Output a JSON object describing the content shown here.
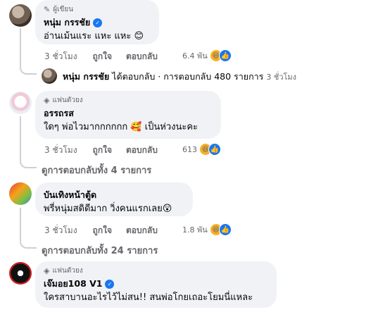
{
  "comments": [
    {
      "badge": "ผู้เขียน",
      "badge_icon": "pencil-icon",
      "name": "หนุ่ม กรรชัย",
      "verified": true,
      "text": "อ่านเม้นแระ แหะ แหะ 😊",
      "time": "3 ชั่วโมง",
      "like_label": "ถูกใจ",
      "reply_label": "ตอบกลับ",
      "reaction_count": "6.4 พัน",
      "reactions": [
        "haha-icon",
        "like-icon"
      ]
    },
    {
      "badge": "แฟนตัวยง",
      "badge_icon": "diamond-icon",
      "name": "อรรถรส",
      "verified": false,
      "text": "ใดๆ พ่อไวมากกกกกก 🥰 เป็นห่วงนะคะ",
      "time": "3 ชั่วโมง",
      "like_label": "ถูกใจ",
      "reply_label": "ตอบกลับ",
      "reaction_count": "613",
      "reactions": [
        "haha-icon",
        "like-icon"
      ],
      "view_replies": "ดูการตอบกลับทั้ง 4 รายการ"
    },
    {
      "name": "บันเทิงหน้าตู้ด",
      "verified": false,
      "text": "พรี่หนุ่มสดิดีมาก วิ่งคนแรกเลย😲",
      "time": "3 ชั่วโมง",
      "like_label": "ถูกใจ",
      "reply_label": "ตอบกลับ",
      "reaction_count": "1.8 พัน",
      "reactions": [
        "haha-icon",
        "like-icon"
      ],
      "view_replies": "ดูการตอบกลับทั้ง 24 รายการ"
    },
    {
      "badge": "แฟนตัวยง",
      "badge_icon": "diamond-icon",
      "name": "เจ๊มอย108 V1",
      "verified": true,
      "text": "ใครสาบานอะไรไว้ไม่สน!! สนพ่อโกยเถอะโยมนี่แหละ"
    }
  ],
  "reply_summary": {
    "name": "หนุ่ม กรรชัย",
    "action": " ได้ตอบกลับ · การตอบกลับ 480 รายการ ",
    "time": "3 ชั่วโมง"
  },
  "colors": {
    "bubble": "#f0f2f5",
    "secondary_text": "#65676b",
    "verified": "#1877f2",
    "like": "#1877f2",
    "haha": "#f7b125"
  }
}
